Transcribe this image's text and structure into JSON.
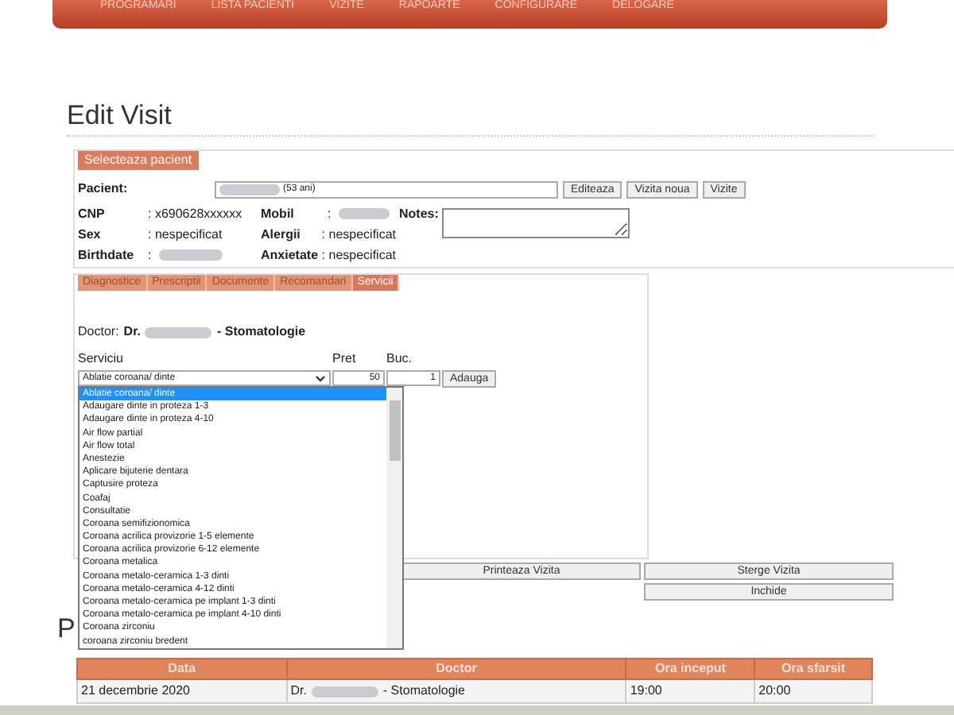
{
  "nav": {
    "items": [
      "PROGRAMARI",
      "LISTA PACIENTI",
      "VIZITE",
      "RAPOARTE",
      "CONFIGURARE",
      "DELOGARE"
    ]
  },
  "title": "Edit Visit",
  "patient": {
    "select_button": "Selecteaza pacient",
    "pacient_label": "Pacient:",
    "pacient_age": "(53 ani)",
    "buttons": [
      "Editeaza",
      "Vizita noua",
      "Vizite"
    ],
    "fields": [
      {
        "label": "CNP",
        "value": ": x690628xxxxxx",
        "blurred": false
      },
      {
        "label": "Sex",
        "value": ": nespecificat",
        "blurred": false
      },
      {
        "label": "Birthdate",
        "value": ":",
        "blurred": true
      }
    ],
    "fields2": [
      {
        "label": "Mobil",
        "value": ":",
        "blurred": true
      },
      {
        "label": "Alergii",
        "value": ": nespecificat",
        "blurred": false
      },
      {
        "label": "Anxietate",
        "value": ": nespecificat",
        "blurred": false
      }
    ],
    "notes_label": "Notes:"
  },
  "tabs": [
    {
      "label": "Diagnostice",
      "selected": false
    },
    {
      "label": "Prescriptii",
      "selected": false
    },
    {
      "label": "Documente",
      "selected": false
    },
    {
      "label": "Recomandari",
      "selected": false
    },
    {
      "label": "Servicii",
      "selected": true
    }
  ],
  "doctor": {
    "label": "Doctor:",
    "prefix": "Dr.",
    "specialty": "- Stomatologie"
  },
  "service_form": {
    "serviciu_label": "Serviciu",
    "pret_label": "Pret",
    "buc_label": "Buc.",
    "selected_service": "Ablatie coroana/ dinte",
    "pret": "50",
    "buc": "1",
    "add_button": "Adauga"
  },
  "dropdown": [
    {
      "label": "Ablatie coroana/ dinte",
      "selected": true
    },
    {
      "label": "Adaugare dinte in proteza 1-3",
      "selected": false
    },
    {
      "label": "Adaugare dinte in proteza 4-10",
      "selected": false
    },
    {
      "label": "Air flow partial",
      "selected": false
    },
    {
      "label": "Air flow total",
      "selected": false
    },
    {
      "label": "Anestezie",
      "selected": false
    },
    {
      "label": "Aplicare bijuterie dentara",
      "selected": false
    },
    {
      "label": "Captusire proteza",
      "selected": false
    },
    {
      "label": "Coafaj",
      "selected": false
    },
    {
      "label": "Consultatie",
      "selected": false
    },
    {
      "label": "Coroana semifizionomica",
      "selected": false
    },
    {
      "label": "Coroana acrilica provizorie 1-5 elemente",
      "selected": false
    },
    {
      "label": "Coroana acrilica provizorie 6-12 elemente",
      "selected": false
    },
    {
      "label": "Coroana metalica",
      "selected": false
    },
    {
      "label": "Coroana metalo-ceramica 1-3 dinti",
      "selected": false
    },
    {
      "label": "Coroana metalo-ceramica 4-12 dinti",
      "selected": false
    },
    {
      "label": "Coroana metalo-ceramica pe implant 1-3 dinti",
      "selected": false
    },
    {
      "label": "Coroana metalo-ceramica pe implant 4-10 dinti",
      "selected": false
    },
    {
      "label": "Coroana zirconiu",
      "selected": false
    },
    {
      "label": "coroana zirconiu bredent",
      "selected": false
    }
  ],
  "actions": {
    "print": "Printeaza Vizita",
    "delete": "Sterge Vizita",
    "close": "Inchide"
  },
  "section_heading": "P",
  "table": {
    "columns": [
      "Data",
      "Doctor",
      "Ora inceput",
      "Ora sfarsit"
    ],
    "rows": [
      {
        "data": "21 decembrie 2020",
        "doctor_prefix": "Dr.",
        "doctor_specialty": "- Stomatologie",
        "start": "19:00",
        "end": "20:00"
      }
    ]
  }
}
